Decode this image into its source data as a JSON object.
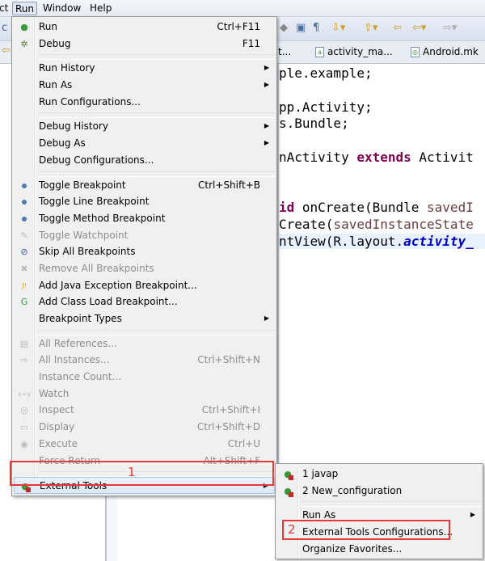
{
  "menubar": {
    "items": [
      "ct",
      "Run",
      "Window",
      "Help"
    ]
  },
  "tabs": [
    "t...",
    "activity_ma...",
    "Android.mk"
  ],
  "editor": {
    "lines": [
      [
        {
          "t": "ple.example;"
        }
      ],
      [],
      [
        {
          "t": "pp.Activity;"
        }
      ],
      [
        {
          "t": "s.Bundle;"
        }
      ],
      [],
      [
        {
          "t": "nActivity "
        },
        {
          "t": "extends",
          "c": "kw"
        },
        {
          "t": " Activit"
        }
      ],
      [],
      [],
      [
        {
          "t": "id",
          "c": "kw"
        },
        {
          "t": " onCreate(Bundle "
        },
        {
          "t": "savedI",
          "c": "var"
        }
      ],
      [
        {
          "t": "Create("
        },
        {
          "t": "savedInstanceState",
          "c": "var"
        }
      ],
      [
        {
          "t": "ntView(R.layout."
        },
        {
          "t": "activity_",
          "c": "fld"
        }
      ]
    ]
  },
  "run_menu": [
    {
      "label": "Run",
      "shortcut": "Ctrl+F11",
      "icon": "run-icon"
    },
    {
      "label": "Debug",
      "shortcut": "F11",
      "icon": "debug-icon"
    },
    {
      "sep": true
    },
    {
      "label": "Run History",
      "sub": true
    },
    {
      "label": "Run As",
      "sub": true
    },
    {
      "label": "Run Configurations..."
    },
    {
      "sep": true
    },
    {
      "label": "Debug History",
      "sub": true
    },
    {
      "label": "Debug As",
      "sub": true
    },
    {
      "label": "Debug Configurations..."
    },
    {
      "sep": true
    },
    {
      "label": "Toggle Breakpoint",
      "shortcut": "Ctrl+Shift+B",
      "icon": "breakpoint-icon"
    },
    {
      "label": "Toggle Line Breakpoint",
      "icon": "breakpoint-icon"
    },
    {
      "label": "Toggle Method Breakpoint",
      "icon": "breakpoint-icon"
    },
    {
      "label": "Toggle Watchpoint",
      "disabled": true,
      "icon": "watchpoint-icon"
    },
    {
      "label": "Skip All Breakpoints",
      "icon": "skip-breakpoints-icon"
    },
    {
      "label": "Remove All Breakpoints",
      "disabled": true,
      "icon": "remove-breakpoints-icon"
    },
    {
      "label": "Add Java Exception Breakpoint...",
      "icon": "java-exception-icon"
    },
    {
      "label": "Add Class Load Breakpoint...",
      "icon": "class-load-icon"
    },
    {
      "label": "Breakpoint Types",
      "sub": true
    },
    {
      "sep": true
    },
    {
      "label": "All References...",
      "disabled": true,
      "icon": "references-icon"
    },
    {
      "label": "All Instances...",
      "shortcut": "Ctrl+Shift+N",
      "disabled": true,
      "icon": "instances-icon"
    },
    {
      "label": "Instance Count...",
      "disabled": true
    },
    {
      "label": "Watch",
      "disabled": true,
      "icon": "watch-icon"
    },
    {
      "label": "Inspect",
      "shortcut": "Ctrl+Shift+I",
      "disabled": true,
      "icon": "inspect-icon"
    },
    {
      "label": "Display",
      "shortcut": "Ctrl+Shift+D",
      "disabled": true,
      "icon": "display-icon"
    },
    {
      "label": "Execute",
      "shortcut": "Ctrl+U",
      "disabled": true,
      "icon": "execute-icon"
    },
    {
      "label": "Force Return",
      "shortcut": "Alt+Shift+F",
      "disabled": true
    },
    {
      "sep": true
    },
    {
      "label": "External Tools",
      "sub": true,
      "highlight": true,
      "icon": "external-tools-icon"
    }
  ],
  "submenu": [
    {
      "label": "1 javap",
      "icon": "external-tools-icon"
    },
    {
      "label": "2 New_configuration",
      "icon": "external-tools-icon"
    },
    {
      "sep": true
    },
    {
      "label": "Run As",
      "sub": true
    },
    {
      "label": "External Tools Configurations..."
    },
    {
      "label": "Organize Favorites..."
    }
  ],
  "annotations": {
    "step1": "1",
    "step2": "2"
  },
  "colors": {
    "annotation": "#e53935"
  }
}
